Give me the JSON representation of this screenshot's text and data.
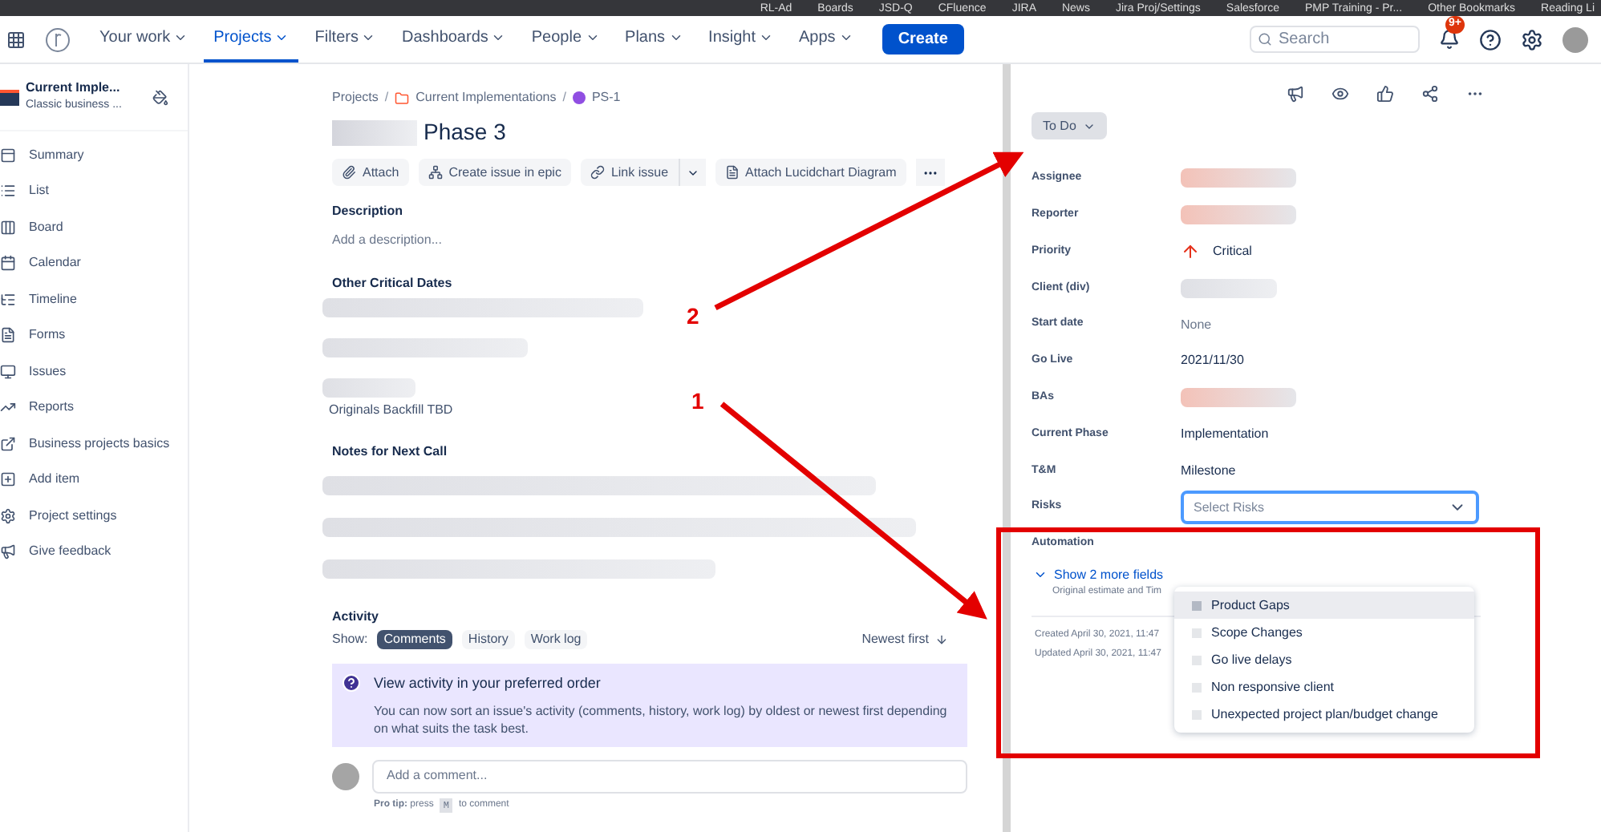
{
  "bookmarks": [
    "RL-Ad",
    "Boards",
    "JSD-Q",
    "CFluence",
    "JIRA",
    "News",
    "Jira Proj/Settings",
    "Salesforce",
    "PMP Training - Pr...",
    "Other Bookmarks",
    "Reading Li"
  ],
  "nav": {
    "items": [
      {
        "label": "Your work",
        "selected": false
      },
      {
        "label": "Projects",
        "selected": true
      },
      {
        "label": "Filters",
        "selected": false
      },
      {
        "label": "Dashboards",
        "selected": false
      },
      {
        "label": "People",
        "selected": false
      },
      {
        "label": "Plans",
        "selected": false
      },
      {
        "label": "Insight",
        "selected": false
      },
      {
        "label": "Apps",
        "selected": false
      }
    ],
    "create": "Create",
    "search_placeholder": "Search",
    "notification_badge": "9+"
  },
  "sidebar": {
    "project": "Current Imple...",
    "project_type": "Classic business ...",
    "items": [
      {
        "label": "Summary"
      },
      {
        "label": "List"
      },
      {
        "label": "Board"
      },
      {
        "label": "Calendar"
      },
      {
        "label": "Timeline"
      },
      {
        "label": "Forms"
      },
      {
        "label": "Issues"
      },
      {
        "label": "Reports"
      },
      {
        "label": "Business projects basics"
      },
      {
        "label": "Add item"
      },
      {
        "label": "Project settings"
      },
      {
        "label": "Give feedback"
      }
    ]
  },
  "breadcrumbs": [
    "Projects",
    "Current Implementations",
    "PS-1"
  ],
  "breadcrumb_separator": "/",
  "issue": {
    "title": "Phase 3",
    "actions": [
      "Attach",
      "Create issue in epic",
      "Link issue",
      "Attach Lucidchart Diagram"
    ],
    "description_label": "Description",
    "description_placeholder": "Add a description...",
    "critical_dates_label": "Other Critical Dates",
    "partial_line": "Originals Backfill TBD",
    "notes_label": "Notes for Next Call"
  },
  "activity": {
    "label": "Activity",
    "show": "Show:",
    "tabs": [
      {
        "label": "Comments",
        "selected": true
      },
      {
        "label": "History",
        "selected": false
      },
      {
        "label": "Work log",
        "selected": false
      }
    ],
    "sort": "Newest first",
    "notice_title": "View activity in your preferred order",
    "notice_body": "You can now sort an issue's activity (comments, history, work log) by oldest or newest first depending on what suits the task best.",
    "comment_placeholder": "Add a comment...",
    "pro_tip": "**Pro tip:** press",
    "pro_tip_key": "M",
    "pro_tip_end": "to comment"
  },
  "status": "To Do",
  "fields": [
    {
      "label": "Assignee",
      "kind": "redacted"
    },
    {
      "label": "Reporter",
      "kind": "redacted"
    },
    {
      "label": "Priority",
      "kind": "priority",
      "value": "Critical"
    },
    {
      "label": "Client (div)",
      "kind": "redacted"
    },
    {
      "label": "Start date",
      "kind": "muted",
      "value": "None"
    },
    {
      "label": "Go Live",
      "kind": "text",
      "value": "2021/11/30"
    },
    {
      "label": "BAs",
      "kind": "redacted"
    },
    {
      "label": "Current Phase",
      "kind": "text",
      "value": "Implementation"
    },
    {
      "label": "T&M",
      "kind": "text",
      "value": "Milestone"
    },
    {
      "label": "Risks",
      "kind": "select",
      "placeholder": "Select Risks"
    },
    {
      "label": "Automation",
      "kind": "empty"
    }
  ],
  "risk_options": [
    {
      "label": "Product Gaps",
      "highlighted": true,
      "checked": false
    },
    {
      "label": "Scope Changes",
      "highlighted": false,
      "checked": false
    },
    {
      "label": "Go live delays",
      "highlighted": false,
      "checked": false
    },
    {
      "label": "Non responsive client",
      "highlighted": false,
      "checked": false
    },
    {
      "label": "Unexpected project plan/budget change",
      "highlighted": false,
      "checked": false
    }
  ],
  "more_fields": "Show 2 more fields",
  "more_fields_hint": "Original estimate and Tim",
  "created": "Created April 30, 2021, 11:47",
  "updated": "Updated April 30, 2021, 11:47",
  "annotations": [
    "2",
    "1"
  ]
}
